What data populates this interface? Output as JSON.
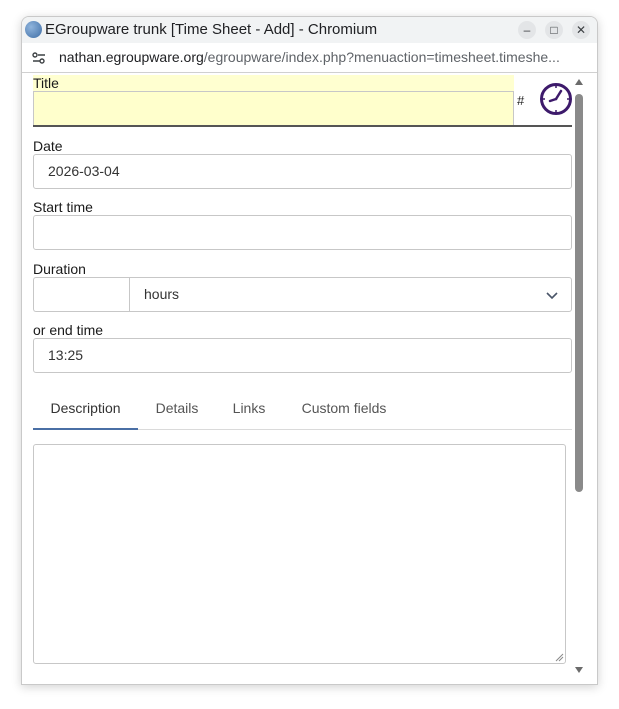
{
  "window": {
    "title": "EGroupware trunk [Time Sheet - Add] - Chromium",
    "minimize_glyph": "–",
    "maximize_glyph": "□",
    "close_glyph": "✕"
  },
  "address": {
    "host": "nathan.egroupware.org",
    "path": "/egroupware/index.php?menuaction=timesheet.timeshe..."
  },
  "form": {
    "title_label": "Title",
    "title_value": "",
    "hash": "#",
    "date_label": "Date",
    "date_value": "2026-03-04",
    "start_time_label": "Start time",
    "start_time_value": "",
    "duration_label": "Duration",
    "duration_value": "",
    "duration_unit": "hours",
    "end_time_label": "or end time",
    "end_time_value": "13:25"
  },
  "tabs": [
    {
      "label": "Description"
    },
    {
      "label": "Details"
    },
    {
      "label": "Links"
    },
    {
      "label": "Custom fields"
    }
  ],
  "colors": {
    "title_highlight": "#ffffcc",
    "clock": "#3d1a6b",
    "active_tab": "#4a6fa5"
  },
  "icons": {
    "clock": "clock-icon",
    "site": "site-info-icon",
    "chevron": "chevron-down-icon"
  }
}
